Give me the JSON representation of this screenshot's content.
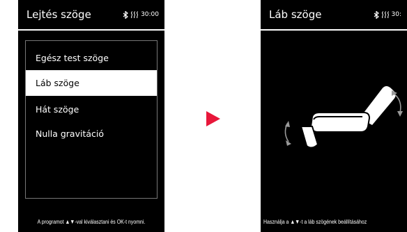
{
  "left_screen": {
    "title": "Lejtés szöge",
    "timer": "30:00",
    "menu": [
      {
        "label": "Egész test szöge",
        "selected": false
      },
      {
        "label": "Láb szöge",
        "selected": true
      },
      {
        "label": "Hát szöge",
        "selected": false
      },
      {
        "label": "Nulla gravitáció",
        "selected": false
      }
    ],
    "footer": "A programot ▲▼-val kiválasztani és OK-t nyomni."
  },
  "right_screen": {
    "title": "Láb szöge",
    "timer": "30:",
    "footer": "Használja a ▲▼-t a láb szögének beállításához"
  },
  "icons": {
    "bluetooth": "bluetooth-icon",
    "heat": "heat-icon",
    "next": "play-arrow-icon",
    "chair": "massage-chair-icon",
    "rotate": "rotate-arrow-icon"
  },
  "colors": {
    "screen_bg": "#000000",
    "text": "#ffffff",
    "selected_bg": "#ffffff",
    "selected_text": "#000000",
    "arrow": "#e8173a",
    "rotate_arrow": "#9a9a9a"
  }
}
